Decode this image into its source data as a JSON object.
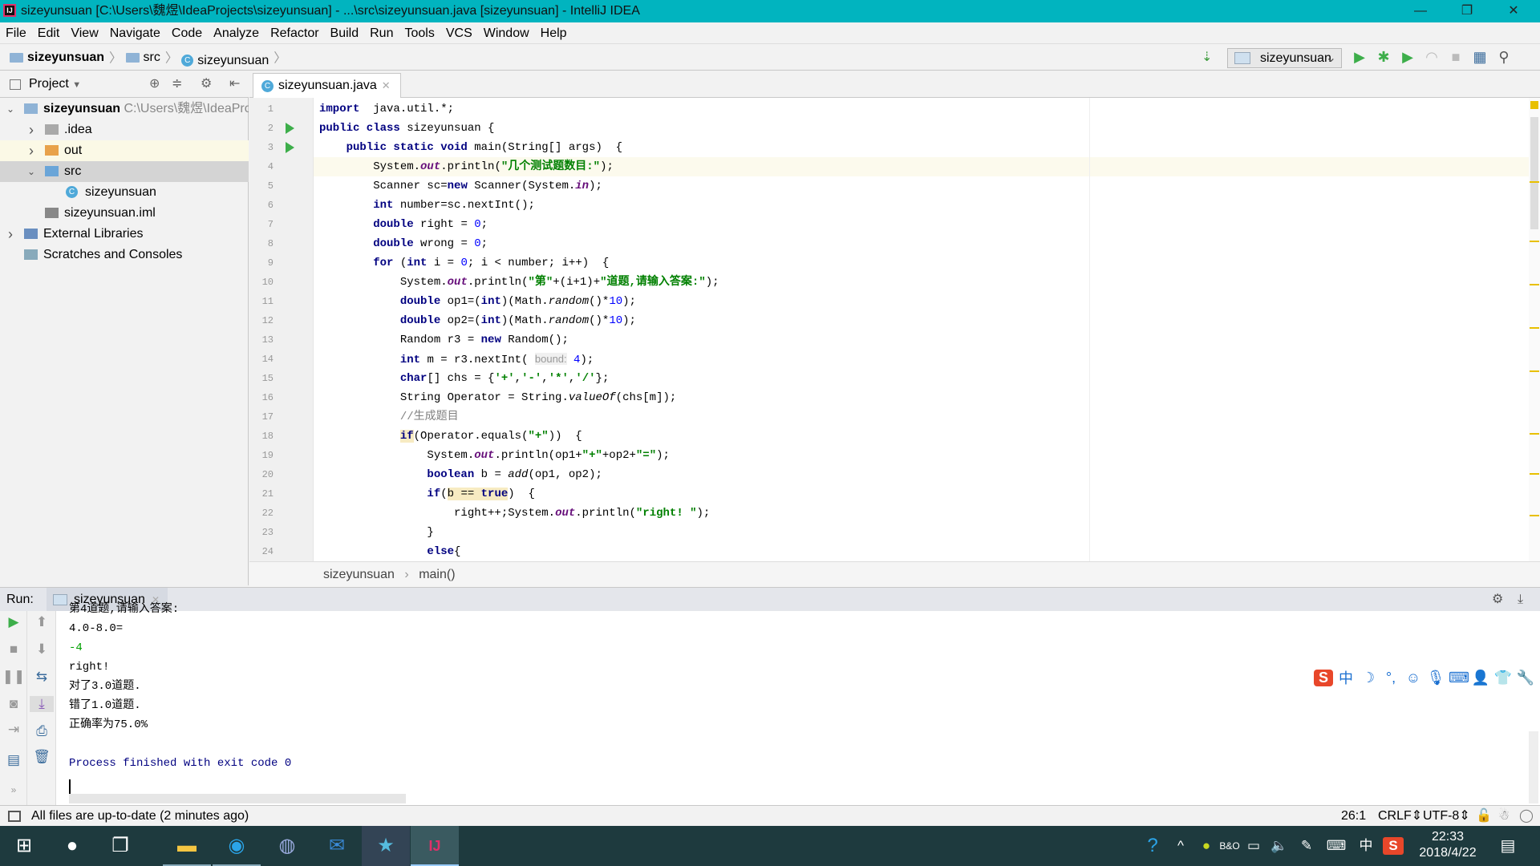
{
  "window": {
    "title": "sizeyunsuan [C:\\Users\\魏煜\\IdeaProjects\\sizeyunsuan] - ...\\src\\sizeyunsuan.java [sizeyunsuan] - IntelliJ IDEA",
    "logo": "IJ"
  },
  "menu": [
    "File",
    "Edit",
    "View",
    "Navigate",
    "Code",
    "Analyze",
    "Refactor",
    "Build",
    "Run",
    "Tools",
    "VCS",
    "Window",
    "Help"
  ],
  "nav": {
    "project": "sizeyunsuan",
    "src": "src",
    "file": "sizeyunsuan"
  },
  "run_config": "sizeyunsuan",
  "project_panel": {
    "title": "Project",
    "tree": [
      {
        "label": "sizeyunsuan",
        "path": "C:\\Users\\魏煜\\IdeaProjects\\sizeyunsuan",
        "depth": 0,
        "expanded": true,
        "icon": "module-icon",
        "bold": true
      },
      {
        "label": ".idea",
        "depth": 1,
        "expanded": false,
        "icon": "folder-icon"
      },
      {
        "label": "out",
        "depth": 1,
        "expanded": false,
        "icon": "folder-orange-icon",
        "highlight": true
      },
      {
        "label": "src",
        "depth": 1,
        "expanded": true,
        "icon": "source-folder-icon",
        "selected": true
      },
      {
        "label": "sizeyunsuan",
        "depth": 2,
        "icon": "java-class-icon"
      },
      {
        "label": "sizeyunsuan.iml",
        "depth": 1,
        "icon": "iml-file-icon"
      },
      {
        "label": "External Libraries",
        "depth": 0,
        "expanded": false,
        "icon": "libraries-icon"
      },
      {
        "label": "Scratches and Consoles",
        "depth": 0,
        "icon": "scratches-icon"
      }
    ]
  },
  "editor": {
    "tab": "sizeyunsuan.java",
    "current_line": 4,
    "lines": [
      [
        [
          "kw",
          "import"
        ],
        [
          "",
          "  java.util.*;"
        ]
      ],
      [
        [
          "kw",
          "public class"
        ],
        [
          "",
          " sizeyunsuan {"
        ]
      ],
      [
        [
          "",
          "    "
        ],
        [
          "kw",
          "public static void"
        ],
        [
          "",
          " main(String[] args)  {"
        ]
      ],
      [
        [
          "",
          "        System."
        ],
        [
          "fld",
          "out"
        ],
        [
          "",
          ".println("
        ],
        [
          "str",
          "\"几个测试题数目:\""
        ],
        [
          "",
          ");"
        ]
      ],
      [
        [
          "",
          "        Scanner sc="
        ],
        [
          "kw",
          "new"
        ],
        [
          "",
          " Scanner(System."
        ],
        [
          "fld",
          "in"
        ],
        [
          "",
          ");"
        ]
      ],
      [
        [
          "",
          "        "
        ],
        [
          "kw",
          "int"
        ],
        [
          "",
          " number=sc.nextInt();"
        ]
      ],
      [
        [
          "",
          "        "
        ],
        [
          "kw",
          "double"
        ],
        [
          "",
          " right = "
        ],
        [
          "num",
          "0"
        ],
        [
          "",
          ";"
        ]
      ],
      [
        [
          "",
          "        "
        ],
        [
          "kw",
          "double"
        ],
        [
          "",
          " wrong = "
        ],
        [
          "num",
          "0"
        ],
        [
          "",
          ";"
        ]
      ],
      [
        [
          "",
          "        "
        ],
        [
          "kw",
          "for"
        ],
        [
          "",
          " ("
        ],
        [
          "kw",
          "int"
        ],
        [
          "",
          " i = "
        ],
        [
          "num",
          "0"
        ],
        [
          "",
          "; i < number; i++)  {"
        ]
      ],
      [
        [
          "",
          "            System."
        ],
        [
          "fld",
          "out"
        ],
        [
          "",
          ".println("
        ],
        [
          "str",
          "\"第\""
        ],
        [
          "",
          "+(i+1)+"
        ],
        [
          "str",
          "\"道题,请输入答案:\""
        ],
        [
          "",
          ");"
        ]
      ],
      [
        [
          "",
          "            "
        ],
        [
          "kw",
          "double"
        ],
        [
          "",
          " op1=("
        ],
        [
          "kw",
          "int"
        ],
        [
          "",
          ")(Math."
        ],
        [
          "it",
          "random"
        ],
        [
          "",
          "()*"
        ],
        [
          "num",
          "10"
        ],
        [
          "",
          ");"
        ]
      ],
      [
        [
          "",
          "            "
        ],
        [
          "kw",
          "double"
        ],
        [
          "",
          " op2=("
        ],
        [
          "kw",
          "int"
        ],
        [
          "",
          ")(Math."
        ],
        [
          "it",
          "random"
        ],
        [
          "",
          "()*"
        ],
        [
          "num",
          "10"
        ],
        [
          "",
          ");"
        ]
      ],
      [
        [
          "",
          "            Random r3 = "
        ],
        [
          "kw",
          "new"
        ],
        [
          "",
          " Random();"
        ]
      ],
      [
        [
          "",
          "            "
        ],
        [
          "kw",
          "int"
        ],
        [
          "",
          " m = r3.nextInt( "
        ],
        [
          "hint",
          "bound:"
        ],
        [
          "",
          " "
        ],
        [
          "num",
          "4"
        ],
        [
          "",
          ");"
        ]
      ],
      [
        [
          "",
          "            "
        ],
        [
          "kw",
          "char"
        ],
        [
          "",
          "[] chs = {"
        ],
        [
          "str",
          "'+'"
        ],
        [
          "",
          ","
        ],
        [
          "str",
          "'-'"
        ],
        [
          "",
          ","
        ],
        [
          "str",
          "'*'"
        ],
        [
          "",
          ","
        ],
        [
          "str",
          "'/'"
        ],
        [
          "",
          "};"
        ]
      ],
      [
        [
          "",
          "            String Operator = String."
        ],
        [
          "it",
          "valueOf"
        ],
        [
          "",
          "(chs[m]);"
        ]
      ],
      [
        [
          "",
          "            "
        ],
        [
          "cm",
          "//生成题目"
        ]
      ],
      [
        [
          "",
          "            "
        ],
        [
          "kw hl",
          "if"
        ],
        [
          "",
          "(Operator.equals("
        ],
        [
          "str",
          "\"+\""
        ],
        [
          "",
          "))  {"
        ]
      ],
      [
        [
          "",
          "                System."
        ],
        [
          "fld",
          "out"
        ],
        [
          "",
          ".println(op1+"
        ],
        [
          "str",
          "\"+\""
        ],
        [
          "",
          "+op2+"
        ],
        [
          "str",
          "\"=\""
        ],
        [
          "",
          ");"
        ]
      ],
      [
        [
          "",
          "                "
        ],
        [
          "kw",
          "boolean"
        ],
        [
          "",
          " b = "
        ],
        [
          "it",
          "add"
        ],
        [
          "",
          "(op1, op2);"
        ]
      ],
      [
        [
          "",
          "                "
        ],
        [
          "kw",
          "if"
        ],
        [
          "",
          "("
        ],
        [
          "hl",
          "b == "
        ],
        [
          "kw hl",
          "true"
        ],
        [
          "",
          ")  {"
        ]
      ],
      [
        [
          "",
          "                    right++;System."
        ],
        [
          "fld",
          "out"
        ],
        [
          "",
          ".println("
        ],
        [
          "str",
          "\"right! \""
        ],
        [
          "",
          ");"
        ]
      ],
      [
        [
          "",
          "                }"
        ]
      ],
      [
        [
          "",
          "                "
        ],
        [
          "kw",
          "else"
        ],
        [
          "",
          "{"
        ]
      ]
    ]
  },
  "editor_breadcrumb": [
    "sizeyunsuan",
    "main()"
  ],
  "run": {
    "label": "Run:",
    "tab": "sizeyunsuan",
    "output": [
      {
        "text": "第4道题,请输入答案:",
        "kind": "normal"
      },
      {
        "text": "4.0-8.0=",
        "kind": "normal"
      },
      {
        "text": "-4",
        "kind": "input"
      },
      {
        "text": "right!",
        "kind": "normal"
      },
      {
        "text": "对了3.0道题.",
        "kind": "normal"
      },
      {
        "text": "错了1.0道题.",
        "kind": "normal"
      },
      {
        "text": "正确率为75.0%",
        "kind": "normal"
      },
      {
        "text": "",
        "kind": "normal"
      },
      {
        "text": "Process finished with exit code 0",
        "kind": "system"
      }
    ]
  },
  "status": {
    "message": "All files are up-to-date (2 minutes ago)",
    "position": "26:1",
    "line_sep": "CRLF",
    "encoding": "UTF-8"
  },
  "ime": {
    "lang": "中"
  },
  "taskbar": {
    "time": "22:33",
    "date": "2018/4/22",
    "ime": "中"
  },
  "colors": {
    "titlebar": "#01b4bf",
    "keyword": "#000080",
    "string": "#008000",
    "number": "#0000ff",
    "field": "#660e7a",
    "console_input": "#00a000",
    "console_system": "#000080"
  }
}
